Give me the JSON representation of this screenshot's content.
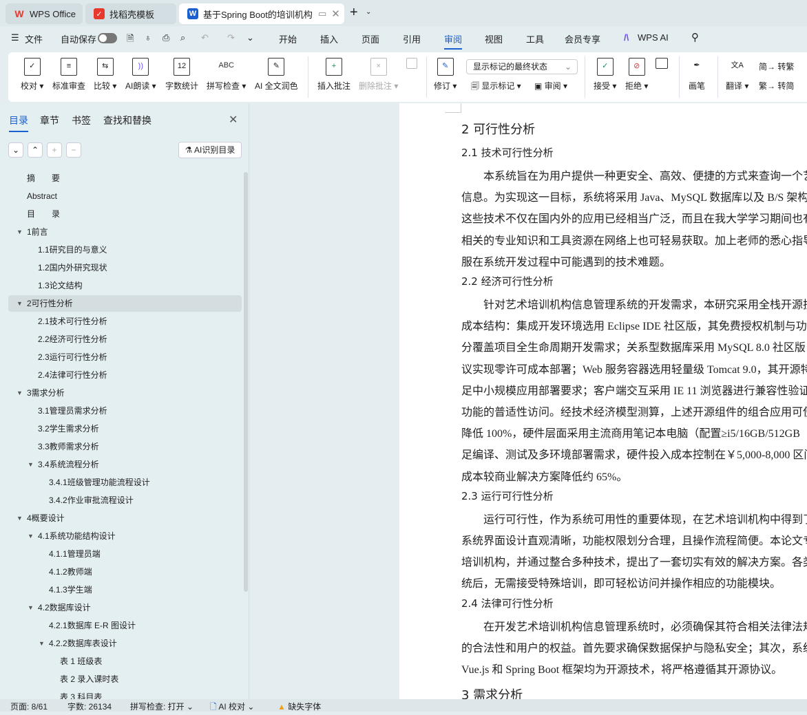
{
  "tabs": [
    {
      "label": "WPS Office",
      "icon": "wps-logo"
    },
    {
      "label": "找稻壳模板",
      "icon": "docer-logo"
    },
    {
      "label": "基于Spring Boot的培训机构",
      "icon": "word-logo",
      "active": true
    }
  ],
  "menu": {
    "file": "文件",
    "autosave": "自动保存",
    "autosave_on": false,
    "items": [
      "开始",
      "插入",
      "页面",
      "引用",
      "审阅",
      "视图",
      "工具",
      "会员专享"
    ],
    "active": "审阅",
    "wps_ai": "WPS AI"
  },
  "ribbon": {
    "group1": [
      "校对",
      "标准审查",
      "比较",
      "AI朗读",
      "字数统计",
      "拼写检查",
      "AI 全文润色"
    ],
    "insert_comment": "插入批注",
    "delete_comment": "删除批注",
    "revise": "修订",
    "markup_select": "显示标记的最终状态",
    "show_markup": "显示标记",
    "review": "审阅",
    "accept": "接受",
    "reject": "拒绝",
    "pen": "画笔",
    "translate": "翻译",
    "to_trad": "转繁",
    "to_simp": "转简",
    "icon_glyphs": {
      "字数统计": "12",
      "拼写检查": "ABC"
    }
  },
  "sidebar": {
    "tabs": [
      "目录",
      "章节",
      "书签",
      "查找和替换"
    ],
    "active": "目录",
    "ai_toc": "AI识别目录",
    "items": [
      {
        "label": "摘　　要",
        "level": 0,
        "arrow": false
      },
      {
        "label": "Abstract",
        "level": 0,
        "arrow": false
      },
      {
        "label": "目　　录",
        "level": 0,
        "arrow": false
      },
      {
        "label": "1前言",
        "level": 0,
        "arrow": true
      },
      {
        "label": "1.1研究目的与意义",
        "level": 1,
        "arrow": false
      },
      {
        "label": "1.2国内外研究现状",
        "level": 1,
        "arrow": false
      },
      {
        "label": "1.3论文结构",
        "level": 1,
        "arrow": false
      },
      {
        "label": "2可行性分析",
        "level": 0,
        "arrow": true,
        "selected": true
      },
      {
        "label": "2.1技术可行性分析",
        "level": 1,
        "arrow": false
      },
      {
        "label": "2.2经济可行性分析",
        "level": 1,
        "arrow": false
      },
      {
        "label": "2.3运行可行性分析",
        "level": 1,
        "arrow": false
      },
      {
        "label": "2.4法律可行性分析",
        "level": 1,
        "arrow": false
      },
      {
        "label": "3需求分析",
        "level": 0,
        "arrow": true
      },
      {
        "label": "3.1管理员需求分析",
        "level": 1,
        "arrow": false
      },
      {
        "label": "3.2学生需求分析",
        "level": 1,
        "arrow": false
      },
      {
        "label": "3.3教师需求分析",
        "level": 1,
        "arrow": false
      },
      {
        "label": "3.4系统流程分析",
        "level": 1,
        "arrow": true
      },
      {
        "label": "3.4.1班级管理功能流程设计",
        "level": 2,
        "arrow": false
      },
      {
        "label": "3.4.2作业审批流程设计",
        "level": 2,
        "arrow": false
      },
      {
        "label": "4概要设计",
        "level": 0,
        "arrow": true
      },
      {
        "label": "4.1系统功能结构设计",
        "level": 1,
        "arrow": true
      },
      {
        "label": "4.1.1管理员端",
        "level": 2,
        "arrow": false
      },
      {
        "label": "4.1.2教师端",
        "level": 2,
        "arrow": false
      },
      {
        "label": "4.1.3学生端",
        "level": 2,
        "arrow": false
      },
      {
        "label": "4.2数据库设计",
        "level": 1,
        "arrow": true
      },
      {
        "label": "4.2.1数据库 E-R 图设计",
        "level": 2,
        "arrow": false
      },
      {
        "label": "4.2.2数据库表设计",
        "level": 2,
        "arrow": true
      },
      {
        "label": "表 1  班级表",
        "level": 3,
        "arrow": false
      },
      {
        "label": "表 2  录入课时表",
        "level": 3,
        "arrow": false
      },
      {
        "label": "表 3  科目表",
        "level": 3,
        "arrow": false
      }
    ]
  },
  "document": {
    "lines": [
      {
        "t": "2  可行性分析",
        "k": "h1"
      },
      {
        "t": "2.1  技术可行性分析",
        "k": "h2"
      },
      {
        "t": "　　本系统旨在为用户提供一种更安全、高效、便捷的方式来查询一个艺",
        "k": "p"
      },
      {
        "t": "信息。为实现这一目标，系统将采用 Java、MySQL 数据库以及 B/S 架构",
        "k": "p"
      },
      {
        "t": "这些技术不仅在国内外的应用已经相当广泛，而且在我大学学习期间也有",
        "k": "p"
      },
      {
        "t": "相关的专业知识和工具资源在网络上也可轻易获取。加上老师的悉心指导",
        "k": "p"
      },
      {
        "t": "服在系统开发过程中可能遇到的技术难题。",
        "k": "p"
      },
      {
        "t": "2.2  经济可行性分析",
        "k": "h2"
      },
      {
        "t": "　　针对艺术培训机构信息管理系统的开发需求，本研究采用全栈开源技",
        "k": "p"
      },
      {
        "t": "成本结构：集成开发环境选用 Eclipse IDE 社区版，其免费授权机制与功",
        "k": "p"
      },
      {
        "t": "分覆盖项目全生命周期开发需求；关系型数据库采用 MySQL 8.0 社区版",
        "k": "p"
      },
      {
        "t": "议实现零许可成本部署；Web 服务容器选用轻量级 Tomcat 9.0，其开源特",
        "k": "p"
      },
      {
        "t": "足中小规模应用部署要求；客户端交互采用 IE 11 浏览器进行兼容性验证",
        "k": "p"
      },
      {
        "t": "功能的普适性访问。经技术经济模型测算，上述开源组件的组合应用可使",
        "k": "p"
      },
      {
        "t": "降低 100%，硬件层面采用主流商用笔记本电脑（配置≥i5/16GB/512GB",
        "k": "p"
      },
      {
        "t": "足编译、测试及多环境部署需求，硬件投入成本控制在￥5,000-8,000 区间",
        "k": "p"
      },
      {
        "t": "成本较商业解决方案降低约 65%。",
        "k": "p"
      },
      {
        "t": "2.3  运行可行性分析",
        "k": "h2"
      },
      {
        "t": "　　运行可行性，作为系统可用性的重要体现，在艺术培训机构中得到了",
        "k": "p"
      },
      {
        "t": "系统界面设计直观清晰，功能权限划分合理，且操作流程简便。本论文专",
        "k": "p"
      },
      {
        "t": "培训机构，并通过整合多种技术，提出了一套切实有效的解决方案。各类",
        "k": "p"
      },
      {
        "t": "统后，无需接受特殊培训，即可轻松访问并操作相应的功能模块。",
        "k": "p"
      },
      {
        "t": "2.4  法律可行性分析",
        "k": "h2"
      },
      {
        "t": "　　在开发艺术培训机构信息管理系统时，必须确保其符合相关法律法规",
        "k": "p"
      },
      {
        "t": "的合法性和用户的权益。首先要求确保数据保护与隐私安全；其次，系统",
        "k": "p"
      },
      {
        "t": "Vue.js 和 Spring Boot 框架均为开源技术，将严格遵循其开源协议。",
        "k": "p"
      },
      {
        "t": "3  需求分析",
        "k": "h1"
      }
    ]
  },
  "status": {
    "page": "页面: 8/61",
    "words": "字数: 26134",
    "spell": "拼写检查: 打开",
    "ai_proof": "AI 校对",
    "missing_font": "缺失字体"
  },
  "colors": {
    "accent": "#1a5fd0",
    "wps_red": "#e8372c",
    "warning": "#f0a020"
  }
}
